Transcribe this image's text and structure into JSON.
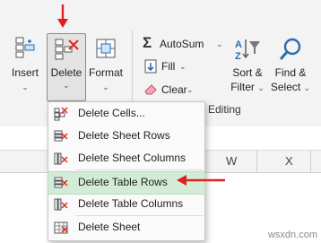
{
  "ribbon": {
    "insert_label": "Insert",
    "delete_label": "Delete",
    "format_label": "Format",
    "autosum_label": "AutoSum",
    "fill_label": "Fill",
    "clear_label": "Clear",
    "sort_filter_line1": "Sort &",
    "sort_filter_line2": "Filter",
    "find_select_line1": "Find &",
    "find_select_line2": "Select",
    "editing_group": "Editing"
  },
  "columns": [
    "W",
    "X"
  ],
  "menu": {
    "items": [
      {
        "label": "Delete Cells...",
        "icon": "delete-cells-icon"
      },
      {
        "label": "Delete Sheet Rows",
        "icon": "delete-sheet-rows-icon"
      },
      {
        "label": "Delete Sheet Columns",
        "icon": "delete-sheet-columns-icon"
      },
      {
        "label": "Delete Table Rows",
        "icon": "delete-table-rows-icon",
        "highlighted": true
      },
      {
        "label": "Delete Table Columns",
        "icon": "delete-table-columns-icon"
      },
      {
        "label": "Delete Sheet",
        "icon": "delete-sheet-icon"
      }
    ]
  },
  "colors": {
    "annotation_arrow": "#e02020",
    "delete_red": "#d93025",
    "highlight": "#d2ecd8"
  },
  "watermark": "wsxdn.com"
}
